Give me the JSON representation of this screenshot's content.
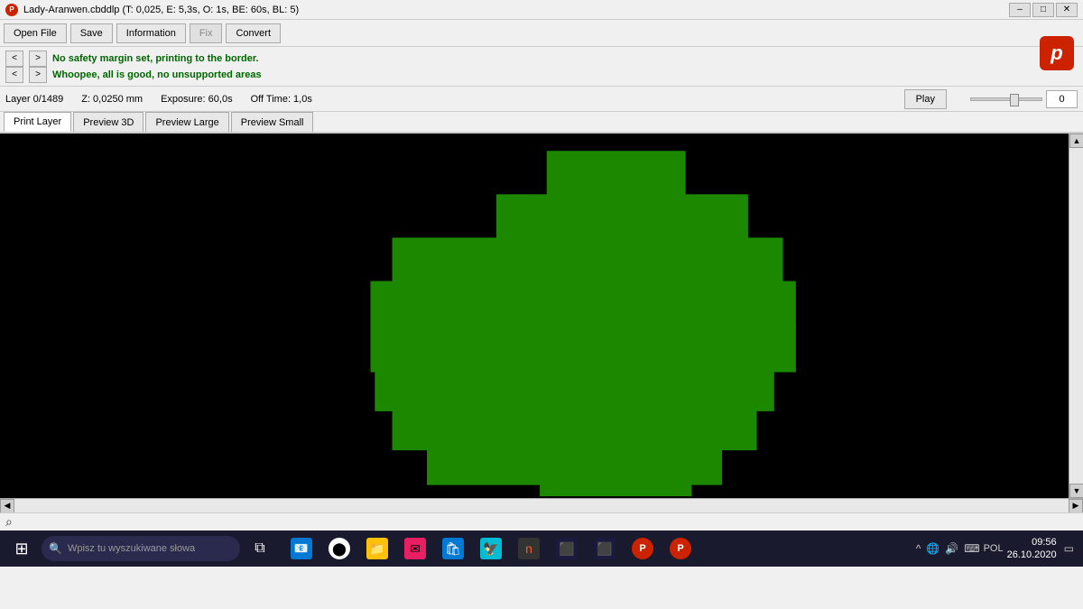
{
  "titlebar": {
    "title": "Lady-Aranwen.cbddlp (T: 0,025, E: 5,3s, O: 1s, BE: 60s, BL: 5)",
    "minimize": "–",
    "maximize": "□",
    "close": "✕"
  },
  "toolbar": {
    "open_file": "Open File",
    "save": "Save",
    "information": "Information",
    "fix": "Fix",
    "convert": "Convert"
  },
  "infobar": {
    "line1": "No safety margin set, printing to the border.",
    "line2": "Whoopee, all is good, no unsupported areas"
  },
  "layerbar": {
    "layer": "Layer 0/1489",
    "z": "Z: 0,0250 mm",
    "exposure": "Exposure: 60,0s",
    "offtime": "Off Time: 1,0s",
    "play": "Play",
    "slider_value": "0"
  },
  "tabs": {
    "print_layer": "Print Layer",
    "preview_3d": "Preview 3D",
    "preview_large": "Preview Large",
    "preview_small": "Preview Small"
  },
  "taskbar": {
    "search_placeholder": "Wpisz tu wyszukiwane słowa",
    "clock_time": "09:56",
    "clock_date": "26.10.2020",
    "language": "POL"
  }
}
